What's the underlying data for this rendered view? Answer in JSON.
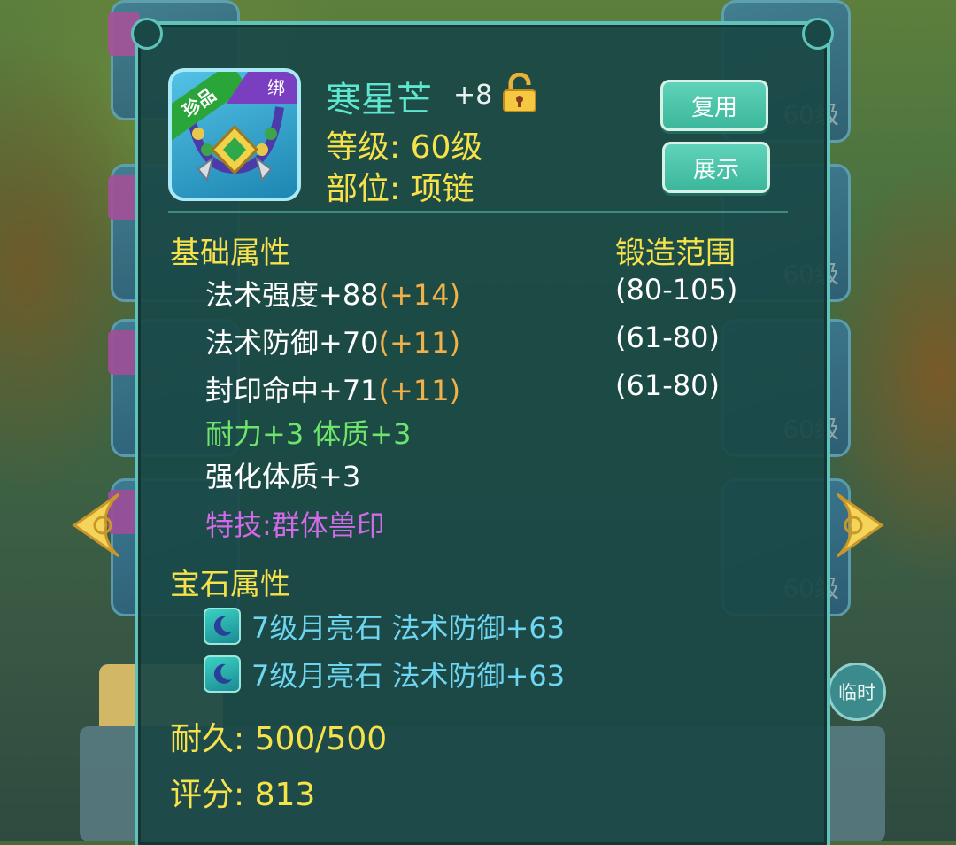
{
  "item": {
    "name": "寒星芒",
    "enhance": "+8",
    "badge_rare": "珍品",
    "badge_bind": "绑",
    "level_line": "等级: 60级",
    "slot_line": "部位: 项链"
  },
  "buttons": {
    "reuse": "复用",
    "show": "展示"
  },
  "basic": {
    "title": "基础属性",
    "range_title": "锻造范围",
    "stats": [
      {
        "text": "法术强度+88",
        "bonus": "(+14)",
        "range": "(80-105)"
      },
      {
        "text": "法术防御+70",
        "bonus": "(+11)",
        "range": "(61-80)"
      },
      {
        "text": "封印命中+71",
        "bonus": "(+11)",
        "range": "(61-80)"
      }
    ],
    "extra_green": "耐力+3 体质+3",
    "strengthen": "强化体质+3",
    "skill": "特技:群体兽印"
  },
  "gems": {
    "title": "宝石属性",
    "items": [
      {
        "text": "7级月亮石 法术防御+63",
        "icon": "moon-gem-icon"
      },
      {
        "text": "7级月亮石 法术防御+63",
        "icon": "moon-gem-icon"
      }
    ]
  },
  "durability": "耐久: 500/500",
  "score": "评分: 813",
  "background": {
    "level_tag": "60级",
    "temp_button": "临时"
  },
  "colors": {
    "panel_border": "#5fc3b9",
    "name": "#5fe6d0",
    "yellow": "#f7e24a",
    "bonus": "#f2b04a",
    "green": "#6ee46b",
    "purple": "#d36ae8",
    "gem": "#6fd6f2"
  }
}
